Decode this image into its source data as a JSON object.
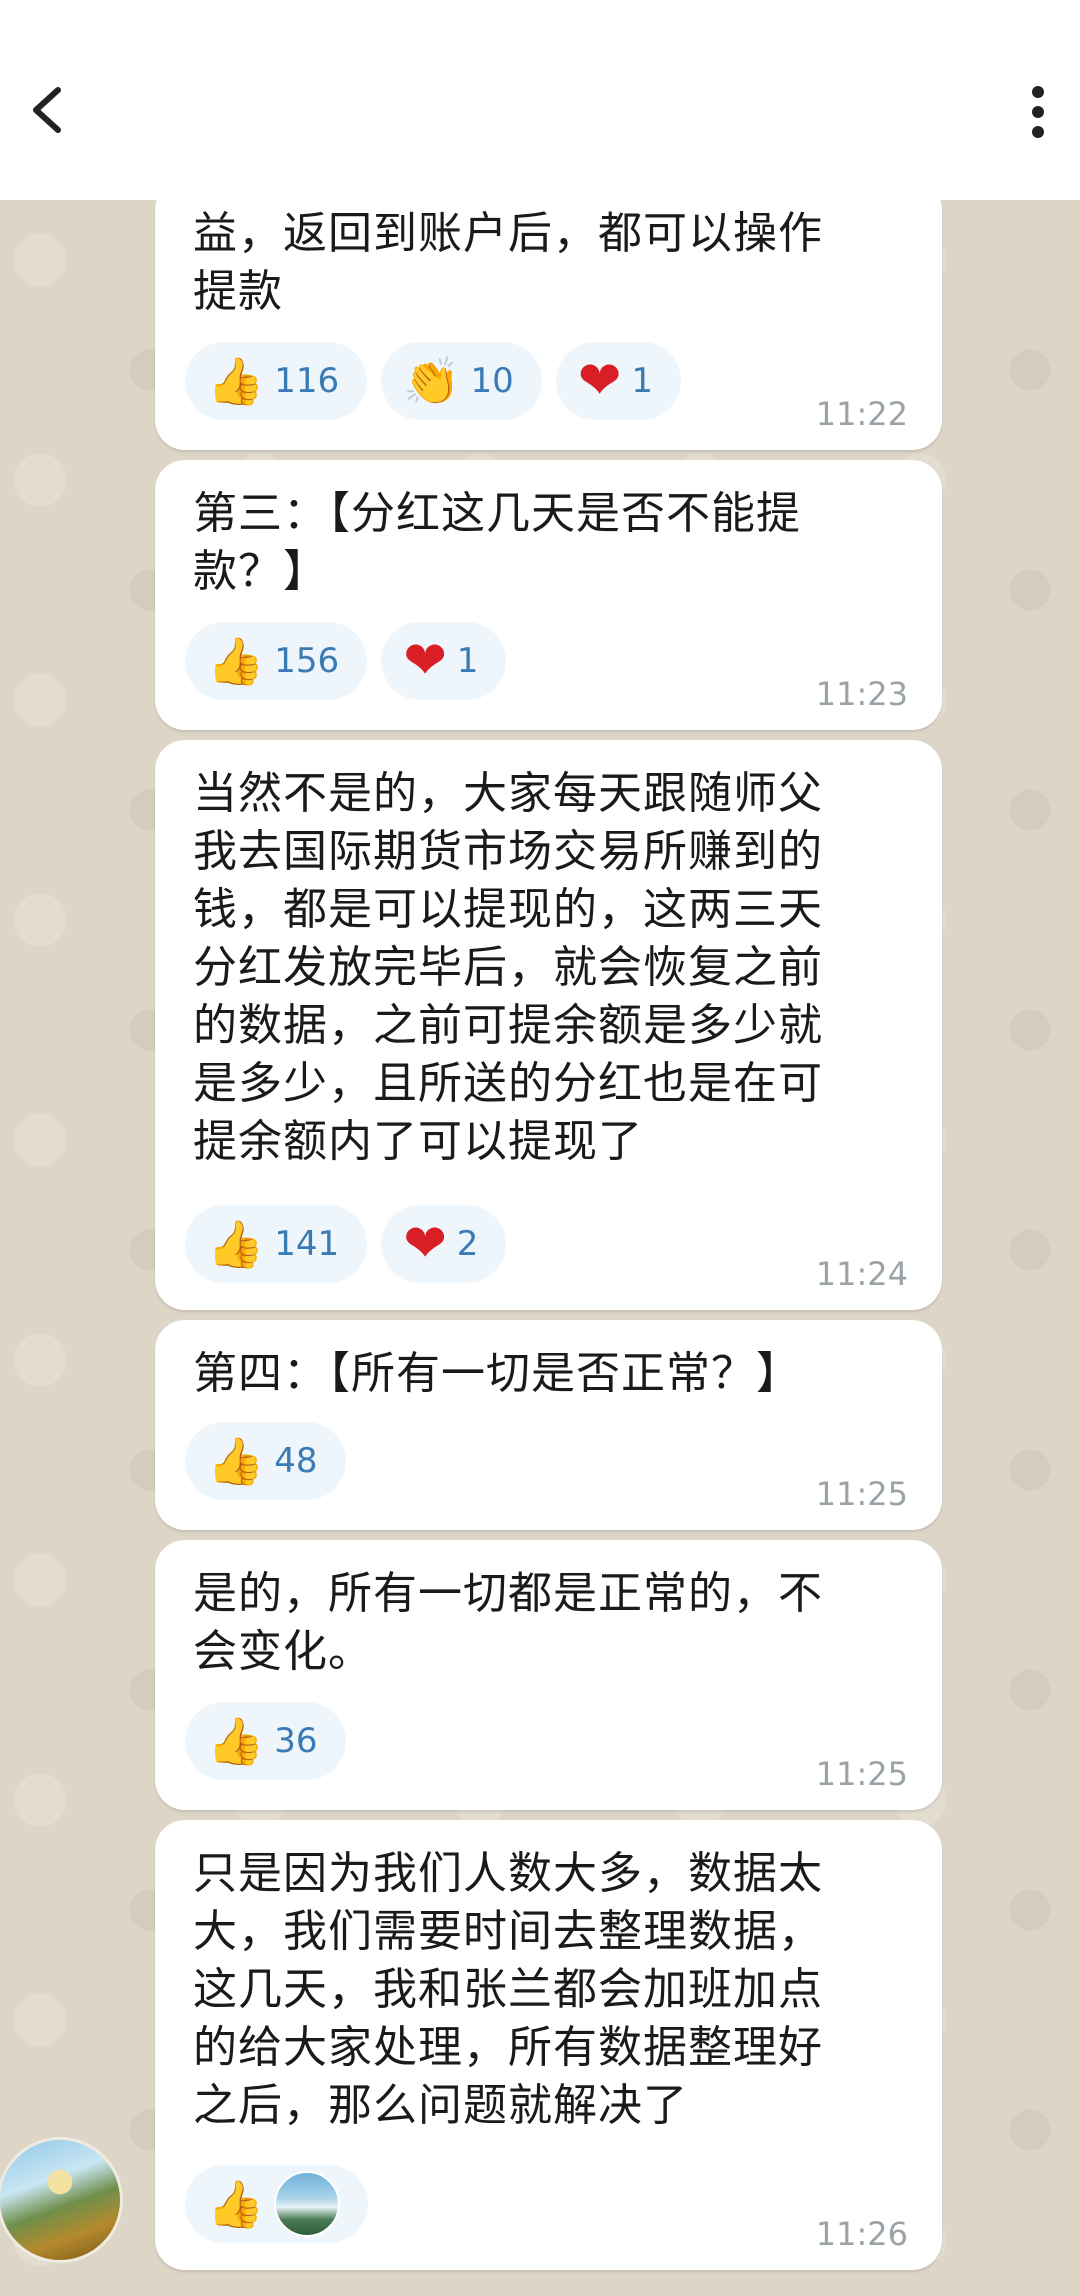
{
  "header": {
    "back_icon": "chevron-left-icon",
    "more_icon": "more-vertical-icon"
  },
  "messages": [
    {
      "text": "益，返回到账户后，都可以操作\n提款",
      "reactions": [
        {
          "icon": "thumbs-up-icon",
          "glyph": "👍",
          "count": "116"
        },
        {
          "icon": "clapping-hands-icon",
          "glyph": "👏",
          "count": "10"
        },
        {
          "icon": "heart-icon",
          "glyph": "❤",
          "count": "1"
        }
      ],
      "time": "11:22"
    },
    {
      "text": "第三：【分红这几天是否不能提\n款？】",
      "reactions": [
        {
          "icon": "thumbs-up-icon",
          "glyph": "👍",
          "count": "156"
        },
        {
          "icon": "heart-icon",
          "glyph": "❤",
          "count": "1"
        }
      ],
      "time": "11:23"
    },
    {
      "text": "当然不是的，大家每天跟随师父\n我去国际期货市场交易所赚到的\n钱，都是可以提现的，这两三天\n分红发放完毕后，就会恢复之前\n的数据，之前可提余额是多少就\n是多少，且所送的分红也是在可\n提余额内了可以提现了",
      "reactions": [
        {
          "icon": "thumbs-up-icon",
          "glyph": "👍",
          "count": "141"
        },
        {
          "icon": "heart-icon",
          "glyph": "❤",
          "count": "2"
        }
      ],
      "time": "11:24"
    },
    {
      "text": "第四：【所有一切是否正常？】",
      "reactions": [
        {
          "icon": "thumbs-up-icon",
          "glyph": "👍",
          "count": "48"
        }
      ],
      "time": "11:25"
    },
    {
      "text": "是的，所有一切都是正常的，不\n会变化。",
      "reactions": [
        {
          "icon": "thumbs-up-icon",
          "glyph": "👍",
          "count": "36"
        }
      ],
      "time": "11:25"
    },
    {
      "text": "只是因为我们人数大多，数据太\n大，我们需要时间去整理数据，\n这几天，我和张兰都会加班加点\n的给大家处理，所有数据整理好\n之后，那么问题就解决了",
      "reactions": [
        {
          "icon": "thumbs-up-icon",
          "glyph": "👍",
          "count": ""
        }
      ],
      "time": "11:26"
    }
  ]
}
